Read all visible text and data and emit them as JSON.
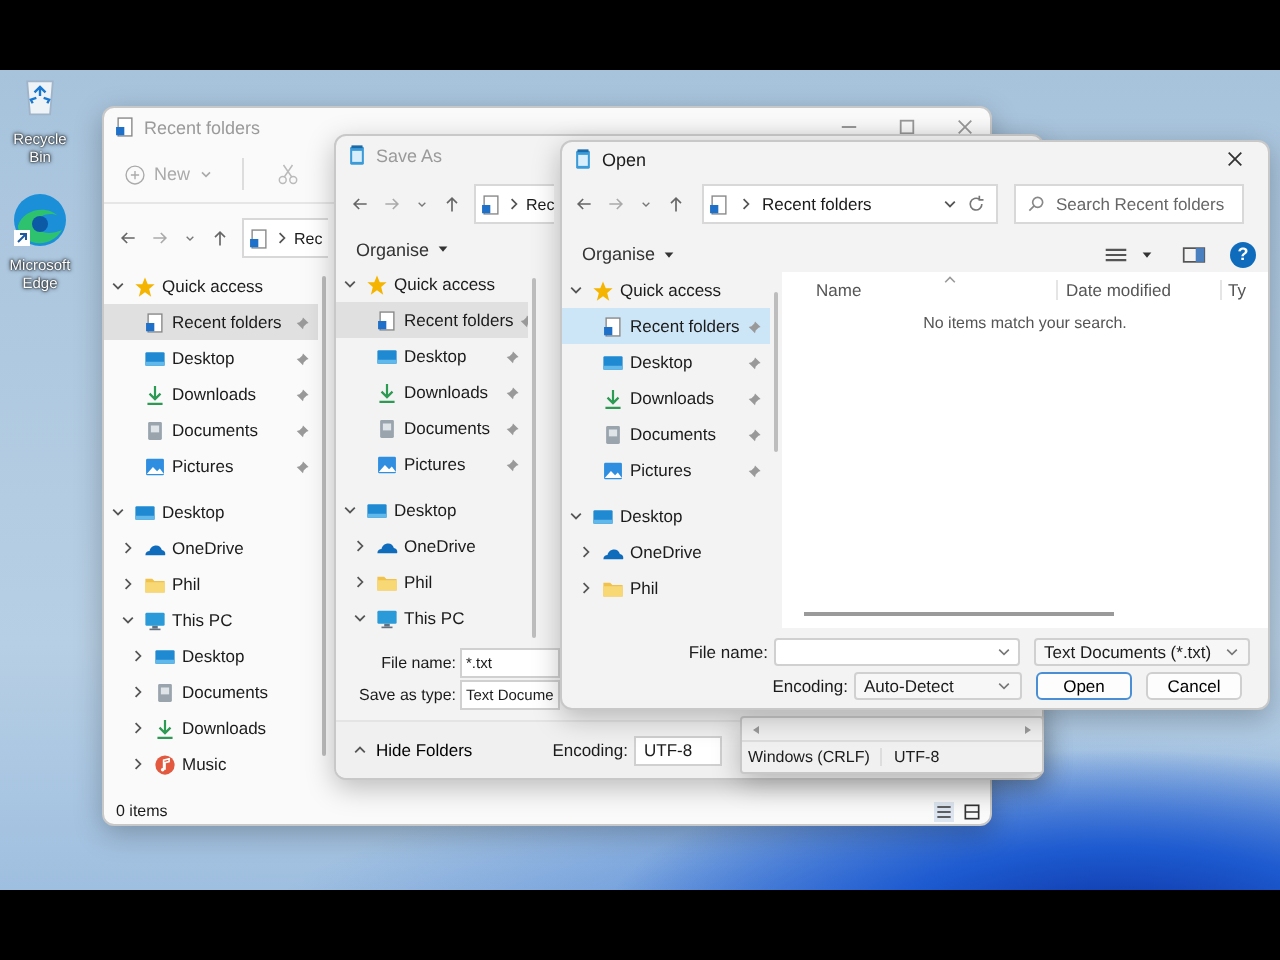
{
  "desktop_icons": [
    {
      "kind": "bin",
      "label": "Recycle Bin"
    },
    {
      "kind": "browser",
      "label": "Microsoft Edge"
    }
  ],
  "explorer": {
    "title": "Recent folders",
    "focused": false,
    "new_label": "New",
    "address": "Rec",
    "sidebar": [
      {
        "label": "Quick access",
        "kind": "star",
        "expanded": true,
        "selected": false,
        "children": [
          {
            "label": "Recent folders",
            "kind": "recent",
            "pinned": true,
            "selected": true
          },
          {
            "label": "Desktop",
            "kind": "desktop",
            "pinned": true,
            "selected": false
          },
          {
            "label": "Downloads",
            "kind": "downloads",
            "pinned": true,
            "selected": false
          },
          {
            "label": "Documents",
            "kind": "documents",
            "pinned": true,
            "selected": false
          },
          {
            "label": "Pictures",
            "kind": "pictures",
            "pinned": true,
            "selected": false
          }
        ]
      },
      {
        "label": "Desktop",
        "kind": "desktop",
        "expanded": true,
        "selected": false,
        "children": [
          {
            "label": "OneDrive",
            "kind": "onedrive",
            "expanded": false,
            "selected": false
          },
          {
            "label": "Phil",
            "kind": "folder",
            "expanded": false,
            "selected": false
          },
          {
            "label": "This PC",
            "kind": "pc",
            "expanded": true,
            "selected": false,
            "children": [
              {
                "label": "Desktop",
                "kind": "desktop",
                "expanded": false,
                "selected": false
              },
              {
                "label": "Documents",
                "kind": "documents",
                "expanded": false,
                "selected": false
              },
              {
                "label": "Downloads",
                "kind": "downloads",
                "expanded": false,
                "selected": false
              },
              {
                "label": "Music",
                "kind": "music",
                "expanded": false,
                "selected": false
              }
            ]
          }
        ]
      }
    ],
    "status": "0 items"
  },
  "save_as": {
    "title": "Save As",
    "focused": false,
    "address": "Rec",
    "organise": "Organise",
    "sidebar": [
      {
        "label": "Quick access",
        "kind": "star",
        "expanded": true,
        "selected": false,
        "children": [
          {
            "label": "Recent folders",
            "kind": "recent",
            "pinned": true,
            "selected": true
          },
          {
            "label": "Desktop",
            "kind": "desktop",
            "pinned": true,
            "selected": false
          },
          {
            "label": "Downloads",
            "kind": "downloads",
            "pinned": true,
            "selected": false
          },
          {
            "label": "Documents",
            "kind": "documents",
            "pinned": true,
            "selected": false
          },
          {
            "label": "Pictures",
            "kind": "pictures",
            "pinned": true,
            "selected": false
          }
        ]
      },
      {
        "label": "Desktop",
        "kind": "desktop",
        "expanded": true,
        "selected": false,
        "children": [
          {
            "label": "OneDrive",
            "kind": "onedrive",
            "expanded": false,
            "selected": false
          },
          {
            "label": "Phil",
            "kind": "folder",
            "expanded": false,
            "selected": false
          },
          {
            "label": "This PC",
            "kind": "pc",
            "expanded": true,
            "selected": false
          }
        ]
      }
    ],
    "file_name_label": "File name:",
    "file_name": "*.txt",
    "type_label": "Save as type:",
    "file_type": "Text Docume",
    "hide_folders": "Hide Folders",
    "encoding_label": "Encoding:",
    "encoding": "UTF-8"
  },
  "notepad_status": {
    "line_ending": "Windows (CRLF)",
    "encoding": "UTF-8"
  },
  "open": {
    "title": "Open",
    "focused": true,
    "address": "Recent folders",
    "search_placeholder": "Search Recent folders",
    "organise": "Organise",
    "help": "?",
    "sidebar": [
      {
        "label": "Quick access",
        "kind": "star",
        "expanded": true,
        "selected": false,
        "children": [
          {
            "label": "Recent folders",
            "kind": "recent",
            "pinned": true,
            "selected": true
          },
          {
            "label": "Desktop",
            "kind": "desktop",
            "pinned": true,
            "selected": false
          },
          {
            "label": "Downloads",
            "kind": "downloads",
            "pinned": true,
            "selected": false
          },
          {
            "label": "Documents",
            "kind": "documents",
            "pinned": true,
            "selected": false
          },
          {
            "label": "Pictures",
            "kind": "pictures",
            "pinned": true,
            "selected": false
          }
        ]
      },
      {
        "label": "Desktop",
        "kind": "desktop",
        "expanded": true,
        "selected": false,
        "children": [
          {
            "label": "OneDrive",
            "kind": "onedrive",
            "expanded": false,
            "selected": false
          },
          {
            "label": "Phil",
            "kind": "folder",
            "expanded": false,
            "selected": false
          }
        ]
      }
    ],
    "columns": [
      "Name",
      "Date modified",
      "Ty"
    ],
    "empty_message": "No items match your search.",
    "file_name_label": "File name:",
    "file_type": "Text Documents (*.txt)",
    "encoding_label": "Encoding:",
    "encoding": "Auto-Detect",
    "buttons": [
      {
        "label": "Open",
        "kind": "default"
      },
      {
        "label": "Cancel",
        "kind": "normal"
      }
    ]
  }
}
